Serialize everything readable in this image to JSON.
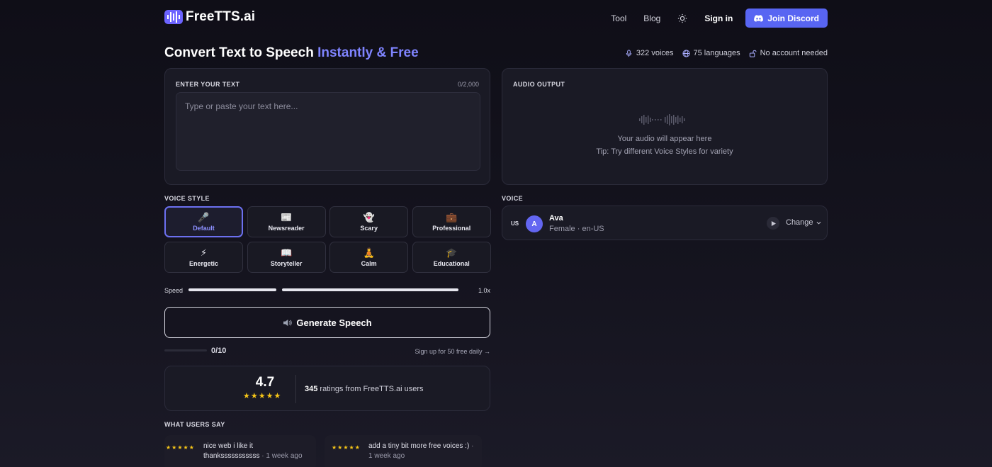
{
  "header": {
    "logo_free": "Free",
    "logo_tts": "TTS.ai",
    "nav": [
      "Tool",
      "Blog"
    ],
    "signin": "Sign in",
    "discord": "Join Discord"
  },
  "title": {
    "main": "Convert Text to Speech ",
    "accent": "Instantly & Free"
  },
  "stats": {
    "voices": "322 voices",
    "languages": "75 languages",
    "account": "No account needed"
  },
  "input": {
    "label": "ENTER YOUR TEXT",
    "count": "0/2,000",
    "placeholder": "Type or paste your text here..."
  },
  "output": {
    "label": "AUDIO OUTPUT",
    "line1": "Your audio will appear here",
    "line2": "Tip: Try different Voice Styles for variety"
  },
  "voice_style": {
    "label": "VOICE STYLE",
    "items": [
      {
        "label": "Default",
        "icon": "🎤"
      },
      {
        "label": "Newsreader",
        "icon": "📰"
      },
      {
        "label": "Scary",
        "icon": "👻"
      },
      {
        "label": "Professional",
        "icon": "💼"
      },
      {
        "label": "Energetic",
        "icon": "⚡"
      },
      {
        "label": "Storyteller",
        "icon": "📖"
      },
      {
        "label": "Calm",
        "icon": "🧘"
      },
      {
        "label": "Educational",
        "icon": "🎓"
      }
    ]
  },
  "speed": {
    "label": "Speed",
    "value": "1.0x"
  },
  "generate": {
    "label": "Generate Speech"
  },
  "usage": {
    "text": "0/10",
    "signup": "Sign up for 50 free daily →"
  },
  "rating": {
    "score": "4.7",
    "stars": "★★★★★",
    "count": "345",
    "text": " ratings from FreeTTS.ai users"
  },
  "reviews": {
    "label": "WHAT USERS SAY",
    "items": [
      {
        "stars": "★★★★★",
        "text": "nice web i like it thanksssssssssss",
        "time": " · 1 week ago"
      },
      {
        "stars": "★★★★★",
        "text": "add a tiny bit more free voices :)",
        "time": " · 1 week ago"
      }
    ]
  },
  "voice": {
    "label": "VOICE",
    "country": "US",
    "avatar": "A",
    "name": "Ava",
    "meta": "Female · en-US",
    "change": "Change"
  },
  "colors": {
    "accent": "#7f84ff",
    "discord": "#5865f2",
    "star": "#f5c518"
  }
}
